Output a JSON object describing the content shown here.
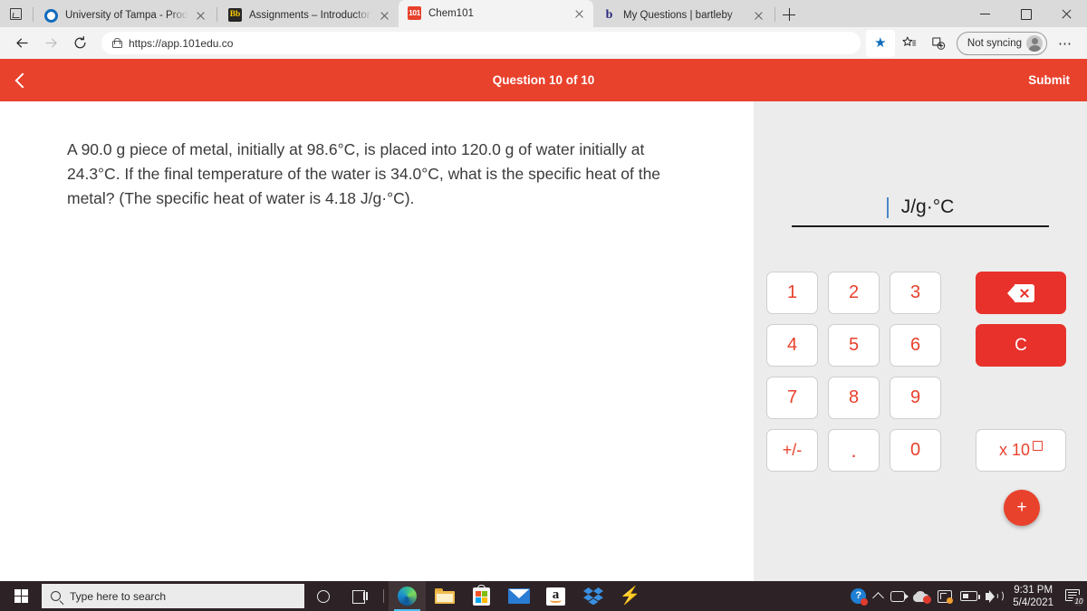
{
  "browser": {
    "tabs": [
      {
        "label": "University of Tampa - Prod - My",
        "favicon": "office-icon",
        "active": false
      },
      {
        "label": "Assignments – Introductory Che",
        "favicon": "blackboard-icon",
        "active": false
      },
      {
        "label": "Chem101",
        "favicon": "chem101-icon",
        "active": true
      },
      {
        "label": "My Questions | bartleby",
        "favicon": "bartleby-icon",
        "active": false
      }
    ],
    "new_tab_label": "+",
    "url": "https://app.101edu.co",
    "profile_label": "Not syncing",
    "window_controls": {
      "minimize": "–",
      "maximize": "❐",
      "close": "✕"
    },
    "toolbar_icons": [
      "back-icon",
      "forward-icon",
      "refresh-icon",
      "lock-icon",
      "favorite-star-icon",
      "favorites-icon",
      "collections-icon",
      "settings-ellipsis-icon"
    ]
  },
  "app": {
    "header": {
      "back_label": "‹",
      "title": "Question 10 of 10",
      "submit_label": "Submit",
      "accent_color": "#e8412c"
    },
    "question": {
      "text": "A 90.0 g piece of metal, initially at 98.6°C, is placed into 120.0 g of water initially at 24.3°C. If the final temperature of the water is 34.0°C, what is the specific heat of the metal? (The specific heat of water is 4.18 J/g·°C)."
    },
    "answer": {
      "value": "",
      "unit": "J/g·°C",
      "caret_color": "#4a86c8"
    },
    "keypad": {
      "digits": [
        "1",
        "2",
        "3",
        "4",
        "5",
        "6",
        "7",
        "8",
        "9",
        "+/-",
        ".",
        "0"
      ],
      "backspace_label": "backspace-icon",
      "clear_label": "C",
      "exponent_label": "x 10",
      "add_label": "+"
    }
  },
  "taskbar": {
    "start_label": "start-icon",
    "search_placeholder": "Type here to search",
    "pinned": [
      "cortana-icon",
      "task-view-icon",
      "edge-icon",
      "file-explorer-icon",
      "microsoft-store-icon",
      "mail-icon",
      "amazon-icon",
      "dropbox-icon",
      "slack-icon"
    ],
    "tray": [
      "help-icon",
      "show-hidden-icons-icon",
      "camera-icon",
      "onedrive-icon",
      "display-icon",
      "battery-icon",
      "volume-icon"
    ],
    "time": "9:31 PM",
    "date": "5/4/2021",
    "notification_count": "10"
  }
}
